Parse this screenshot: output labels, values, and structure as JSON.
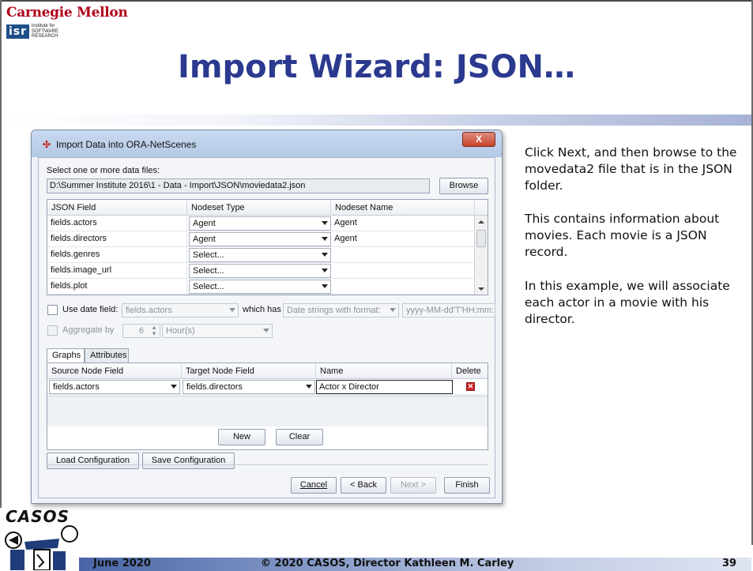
{
  "header": {
    "university": "Carnegie Mellon",
    "institute_logo": "isr",
    "institute_lines": [
      "institute for",
      "SOFTWARE",
      "RESEARCH"
    ],
    "title": "Import Wizard: JSON…"
  },
  "dialog": {
    "icon": "ora-icon",
    "title": "Import Data into ORA-NetScenes",
    "close_label": "X",
    "select_label": "Select one or more data files:",
    "file_path": "D:\\Summer Institute 2016\\1 - Data - Import\\JSON\\moviedata2.json",
    "browse_label": "Browse",
    "field_table": {
      "columns": [
        "JSON Field",
        "Nodeset Type",
        "Nodeset Name"
      ],
      "rows": [
        {
          "field": "fields.actors",
          "type": "Agent",
          "name": "Agent"
        },
        {
          "field": "fields.directors",
          "type": "Agent",
          "name": "Agent"
        },
        {
          "field": "fields.genres",
          "type": "Select...",
          "name": ""
        },
        {
          "field": "fields.image_url",
          "type": "Select...",
          "name": ""
        },
        {
          "field": "fields.plot",
          "type": "Select...",
          "name": ""
        }
      ]
    },
    "date_options": {
      "use_date_label": "Use date field:",
      "date_field": "fields.actors",
      "which_has": "which has",
      "format_type": "Date strings with format:",
      "format_value": "yyyy-MM-dd'T'HH:mm:s",
      "aggregate_label": "Aggregate by",
      "aggregate_value": "6",
      "aggregate_unit": "Hour(s)"
    },
    "tabs": [
      {
        "label": "Graphs",
        "active": true
      },
      {
        "label": "Attributes",
        "active": false
      }
    ],
    "graph_table": {
      "columns": [
        "Source Node Field",
        "Target Node Field",
        "Name",
        "Delete"
      ],
      "rows": [
        {
          "source": "fields.actors",
          "target": "fields.directors",
          "name": "Actor x Director"
        }
      ]
    },
    "new_label": "New",
    "clear_label": "Clear",
    "load_config_label": "Load Configuration",
    "save_config_label": "Save Configuration",
    "cancel_label": "Cancel",
    "back_label": "< Back",
    "next_label": "Next >",
    "finish_label": "Finish"
  },
  "side_notes": [
    "Click Next, and then browse to the movedata2 file that is in the JSON folder.",
    "This contains information about movies. Each movie is a JSON record.",
    "In this example, we will associate each actor in a movie with his director."
  ],
  "footer": {
    "logo_text": "CASOS",
    "date": "June 2020",
    "copyright": "© 2020 CASOS, Director Kathleen M. Carley",
    "page_number": "39"
  },
  "colors": {
    "title": "#2b3a8f",
    "cmu_red": "#b00018",
    "isr_blue": "#1f4e8a"
  }
}
